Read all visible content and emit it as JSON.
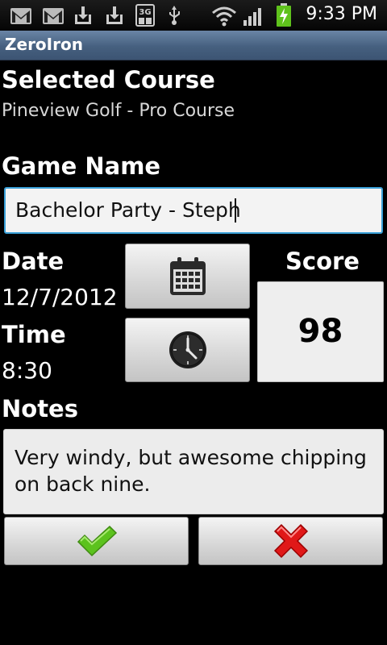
{
  "status_bar": {
    "time": "9:33 PM",
    "icons": [
      "gmail-icon",
      "gmail-icon",
      "download-icon",
      "download-icon",
      "3g-icon",
      "usb-icon",
      "wifi-icon",
      "signal-icon",
      "battery-charging-icon"
    ]
  },
  "app": {
    "title": "ZeroIron"
  },
  "course": {
    "heading": "Selected Course",
    "name": "Pineview Golf - Pro Course"
  },
  "game": {
    "heading": "Game Name",
    "value": "Bachelor Party - Steph"
  },
  "date": {
    "heading": "Date",
    "value": "12/7/2012",
    "button_icon": "calendar-icon"
  },
  "time": {
    "heading": "Time",
    "value": "8:30",
    "button_icon": "clock-icon"
  },
  "score": {
    "heading": "Score",
    "value": "98"
  },
  "notes": {
    "heading": "Notes",
    "value": "Very windy, but awesome chipping on back nine."
  },
  "actions": {
    "confirm_icon": "check-icon",
    "cancel_icon": "x-icon"
  },
  "colors": {
    "titlebar": "#4d6788",
    "input_focus": "#3aa0d8",
    "confirm": "#5cc21e",
    "cancel": "#e01818"
  }
}
